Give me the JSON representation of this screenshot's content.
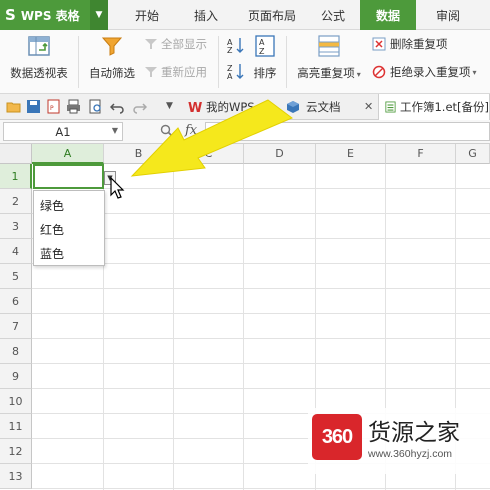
{
  "app": {
    "logo_letter": "S",
    "name": "WPS 表格"
  },
  "tabs": [
    {
      "label": "开始"
    },
    {
      "label": "插入"
    },
    {
      "label": "页面布局"
    },
    {
      "label": "公式"
    },
    {
      "label": "数据",
      "active": true
    },
    {
      "label": "审阅"
    }
  ],
  "ribbon": {
    "pivot": "数据透视表",
    "autofilter": "自动筛选",
    "show_all": "全部显示",
    "reapply": "重新应用",
    "sort": "排序",
    "highlight_dup": "高亮重复项",
    "delete_dup": "删除重复项",
    "reject_dup": "拒绝录入重复项"
  },
  "doc_tabs": [
    {
      "label": "我的WPS"
    },
    {
      "label": "云文档"
    },
    {
      "label": "工作簿1.et[备份]",
      "active": true
    }
  ],
  "formula_bar": {
    "cell_ref": "A1",
    "fx": "fx"
  },
  "columns": [
    "A",
    "B",
    "C",
    "D",
    "E",
    "F",
    "G"
  ],
  "rows": [
    "1",
    "2",
    "3",
    "4",
    "5",
    "6",
    "7",
    "8",
    "9",
    "10",
    "11",
    "12",
    "13"
  ],
  "dropdown": {
    "options": [
      "绿色",
      "红色",
      "蓝色"
    ]
  },
  "watermark": {
    "logo": "360",
    "title": "货源之家",
    "url": "www.360hyzj.com"
  },
  "colors": {
    "accent": "#4d9a3b",
    "arrow": "#f5e81c",
    "watermark_red": "#d9262b"
  }
}
